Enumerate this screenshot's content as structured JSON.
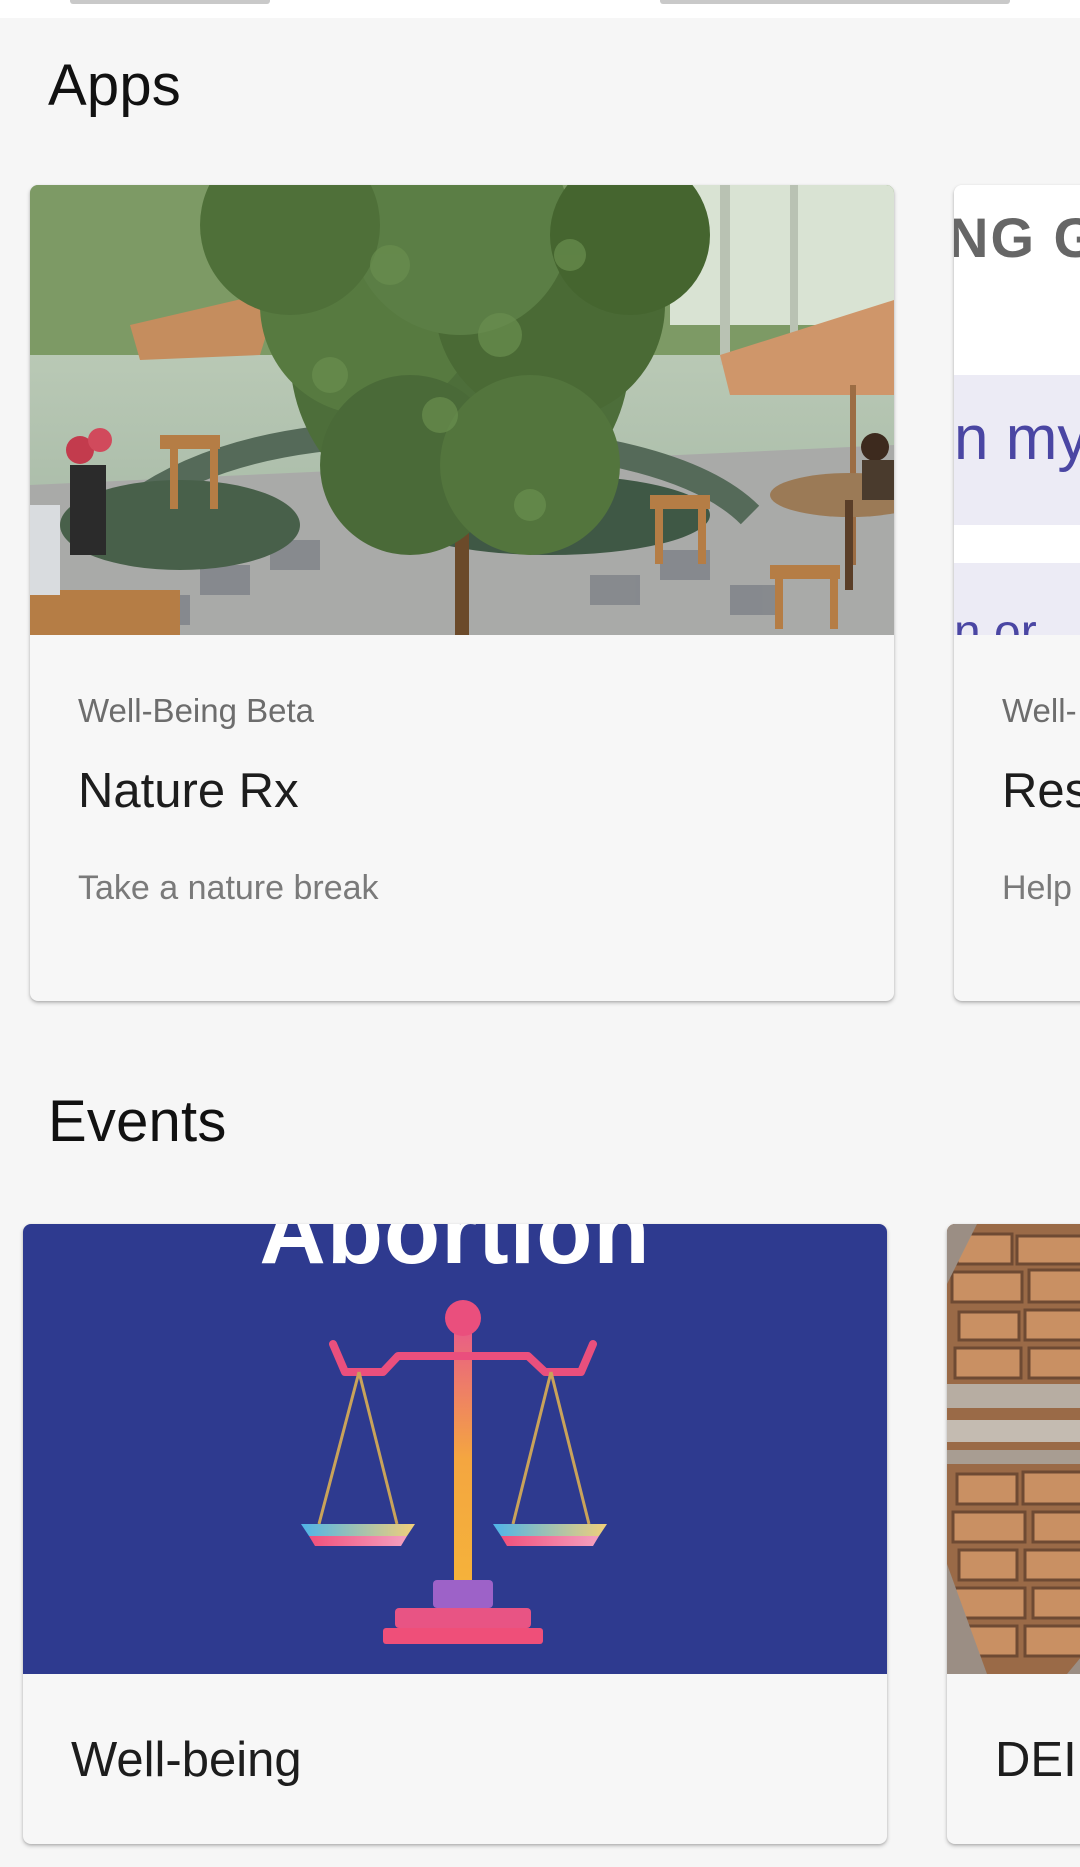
{
  "sections": {
    "apps": {
      "title": "Apps"
    },
    "events": {
      "title": "Events"
    }
  },
  "apps": [
    {
      "eyebrow": "Well-Being Beta",
      "title": "Nature Rx",
      "description": "Take a nature break",
      "image_icon": "garden-patio-photo"
    },
    {
      "eyebrow": "Well-",
      "title": "Res",
      "description": "Help",
      "image_icon": "text-graphic",
      "image_text": [
        "NG G",
        "n my",
        "n or"
      ]
    }
  ],
  "events": [
    {
      "title": "Well-being",
      "banner_text": "Abortion",
      "image_icon": "scales-of-justice-icon",
      "banner_color": "#2e3a8f"
    },
    {
      "title": "DEI",
      "image_icon": "stone-wall-photo"
    }
  ]
}
